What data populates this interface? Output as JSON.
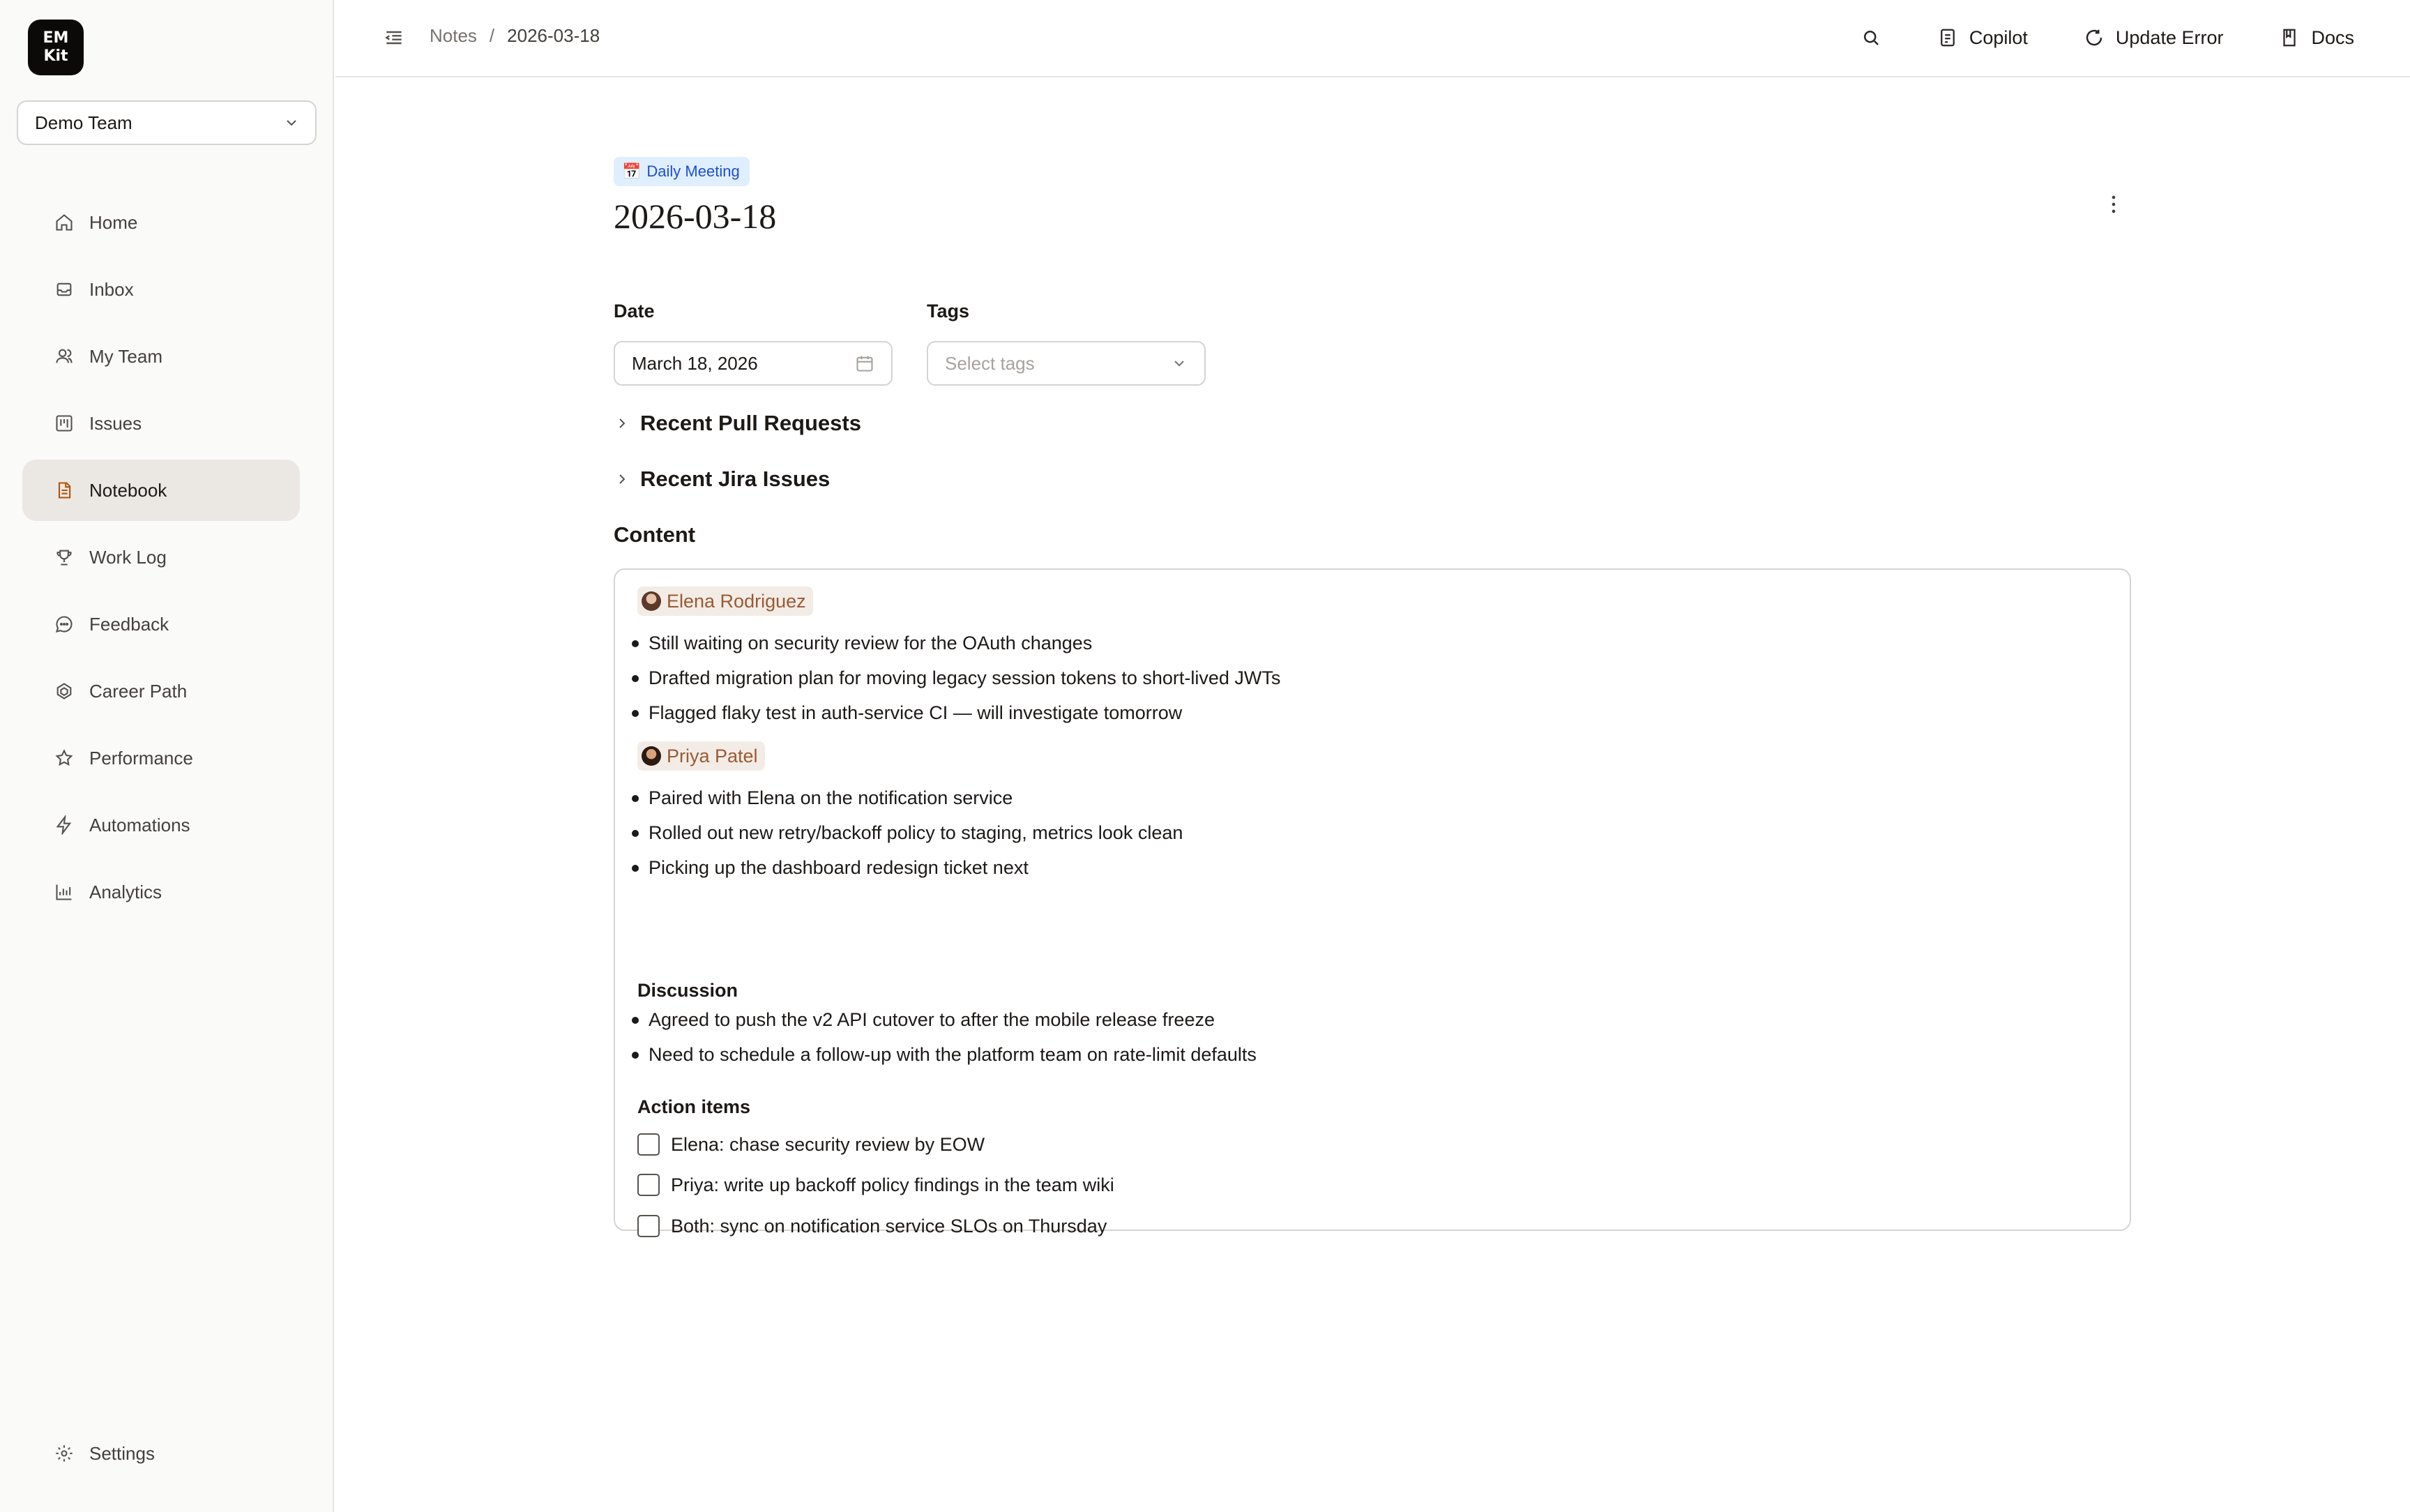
{
  "app": {
    "logo_line1": "EM",
    "logo_line2": "Kit"
  },
  "sidebar": {
    "team": "Demo Team",
    "items": [
      {
        "label": "Home",
        "icon": "home-icon"
      },
      {
        "label": "Inbox",
        "icon": "inbox-icon"
      },
      {
        "label": "My Team",
        "icon": "users-icon"
      },
      {
        "label": "Issues",
        "icon": "kanban-icon"
      },
      {
        "label": "Notebook",
        "icon": "notebook-icon",
        "active": true
      },
      {
        "label": "Work Log",
        "icon": "trophy-icon"
      },
      {
        "label": "Feedback",
        "icon": "message-icon"
      },
      {
        "label": "Career Path",
        "icon": "career-icon"
      },
      {
        "label": "Performance",
        "icon": "star-icon"
      },
      {
        "label": "Automations",
        "icon": "zap-icon"
      },
      {
        "label": "Analytics",
        "icon": "chart-icon"
      }
    ],
    "settings": "Settings"
  },
  "topbar": {
    "breadcrumb": [
      "Notes",
      "2026-03-18"
    ],
    "separator": "/",
    "copilot": "Copilot",
    "update_error": "Update Error",
    "docs": "Docs"
  },
  "note": {
    "badge": "Daily Meeting",
    "badge_emoji": "📅",
    "title": "2026-03-18",
    "date_label": "Date",
    "date_value": "March 18, 2026",
    "tags_label": "Tags",
    "tags_placeholder": "Select tags",
    "sections": [
      "Recent Pull Requests",
      "Recent Jira Issues"
    ],
    "content_label": "Content",
    "people": [
      {
        "name": "Elena Rodriguez",
        "bullets": [
          "Still waiting on security review for the OAuth changes",
          "Drafted migration plan for moving legacy session tokens to short-lived JWTs",
          "Flagged flaky test in auth-service CI — will investigate tomorrow"
        ]
      },
      {
        "name": "Priya Patel",
        "bullets": [
          "Paired with Elena on the notification service",
          "Rolled out new retry/backoff policy to staging, metrics look clean",
          "Picking up the dashboard redesign ticket next"
        ]
      }
    ],
    "discussion": {
      "heading": "Discussion",
      "bullets": [
        "Agreed to push the v2 API cutover to after the mobile release freeze",
        "Need to schedule a follow-up with the platform team on rate-limit defaults"
      ]
    },
    "action_items": {
      "heading": "Action items",
      "items": [
        {
          "text": "Elena: chase security review by EOW",
          "checked": false
        },
        {
          "text": "Priya: write up backoff policy findings in the team wiki",
          "checked": false
        },
        {
          "text": "Both: sync on notification service SLOs on Thursday",
          "checked": false
        }
      ]
    }
  },
  "colors": {
    "accent": "#b45309",
    "badge_bg": "#e0efff",
    "badge_fg": "#1d4ed8",
    "mention_bg": "#f3ece6",
    "mention_fg": "#9a5a34"
  }
}
